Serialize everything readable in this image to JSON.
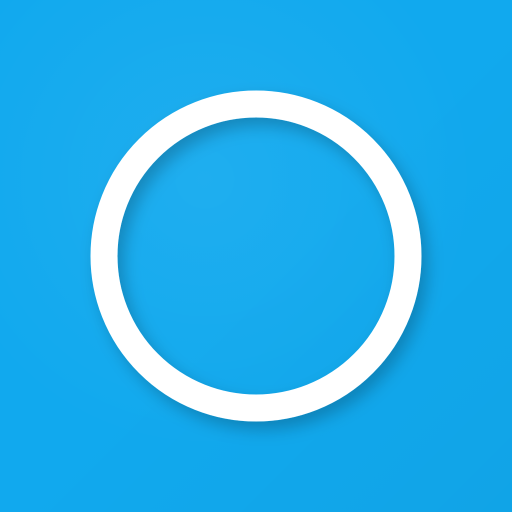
{
  "app": {
    "icon": "ring-icon",
    "colors": {
      "background": "#11A9EE",
      "ring": "#FFFFFF",
      "shadow": "#000000"
    }
  }
}
